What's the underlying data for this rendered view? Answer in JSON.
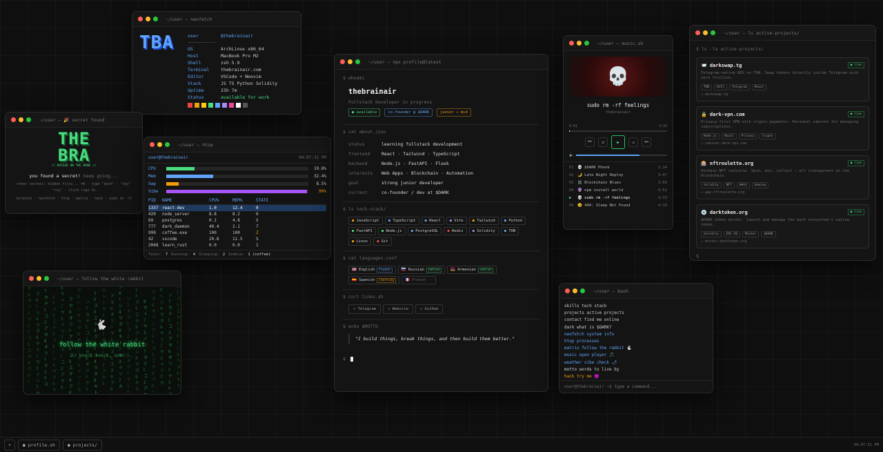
{
  "neofetch": {
    "title": "~/user — neofetch",
    "logo": "TBA",
    "user_label": "user",
    "user_value": "@thebrainair",
    "rows": [
      {
        "k": "OS",
        "v": "ArchLinux x86_64"
      },
      {
        "k": "Host",
        "v": "MacBook Pro M2"
      },
      {
        "k": "Shell",
        "v": "zsh 5.9"
      },
      {
        "k": "Terminal",
        "v": "thebrainair.com"
      },
      {
        "k": "Editor",
        "v": "VSCode + Neovim"
      },
      {
        "k": "Stack",
        "v": "JS TS Python Solidity"
      },
      {
        "k": "Uptime",
        "v": "23h 7m"
      },
      {
        "k": "Status",
        "v": "available for work"
      }
    ],
    "swatches": [
      "#ef4444",
      "#f59e0b",
      "#facc15",
      "#4ade80",
      "#60a5fa",
      "#a78bfa",
      "#ec4899",
      "#ffffff",
      "#555555"
    ]
  },
  "secret": {
    "title": "~/user — 🎉 secret found",
    "logo1": "THE",
    "logo2": "BRA",
    "logo_caption": "// RAISED ON THE BONE //",
    "found": "you found a secret!",
    "keep": "keep going...",
    "hint1": "other secrets: hidden files... ⌘K · type \"bash\" · \"sky\"",
    "hint2": "\"rny\" · click logo 3x",
    "cmds": "terminal · neofetch · htop · matrix · hack · sudo rm -rf"
  },
  "htop": {
    "title": "~/user — htop",
    "header_user": "user@thebrainair",
    "header_time": "04:07:31 PM",
    "meters": [
      {
        "label": "CPU",
        "value": "19.8%",
        "fill": 0.2,
        "color": "#4ade80"
      },
      {
        "label": "Mem",
        "value": "32.4%",
        "fill": 0.33,
        "color": "#60a5fa"
      },
      {
        "label": "Swp",
        "value": "8.5%",
        "fill": 0.085,
        "color": "#f59e0b"
      },
      {
        "label": "Vibe",
        "value": "99%",
        "fill": 0.99,
        "color": "#a855f7"
      }
    ],
    "cols": [
      "PID",
      "NAME",
      "CPU%",
      "MEM%",
      "STATE"
    ],
    "procs": [
      {
        "pid": "1337",
        "name": "react-dev",
        "cpu": "1.0",
        "mem": "12.4",
        "state": "0"
      },
      {
        "pid": "420",
        "name": "node_server",
        "cpu": "8.8",
        "mem": "8.2",
        "state": "0"
      },
      {
        "pid": "69",
        "name": "postgres",
        "cpu": "0.1",
        "mem": "4.8",
        "state": "S"
      },
      {
        "pid": "777",
        "name": "dark_daemon",
        "cpu": "40.4",
        "mem": "2.1",
        "state": "7"
      },
      {
        "pid": "999",
        "name": "coffee.exe",
        "cpu": "100",
        "mem": "100",
        "state": "Z"
      },
      {
        "pid": "42",
        "name": "vscode",
        "cpu": "20.8",
        "mem": "11.5",
        "state": "S"
      },
      {
        "pid": "2048",
        "name": "learn_rust",
        "cpu": "0.0",
        "mem": "0.0",
        "state": "1"
      }
    ],
    "footer": [
      "Tasks:",
      "7",
      "Running:",
      "4",
      "Sleeping:",
      "2",
      "Zombie:",
      "1 (coffee)"
    ]
  },
  "matrix": {
    "title": "~/user — follow the white rabbit",
    "headline": "follow the white rabbit",
    "sub": "// knock knock, user..."
  },
  "profile": {
    "title": "~/user — npx profile@latest",
    "p_whoami": "$ whoami",
    "name": "thebrainair",
    "role": "Fullstack Developer in progress",
    "badges": [
      "● available",
      "co-founder @ $DARK",
      "junior → mid"
    ],
    "p_about": "$ cat about.json",
    "about": [
      {
        "k": "status",
        "v": "learning fullstack development"
      },
      {
        "k": "frontend",
        "v": "React · Tailwind · TypeScript"
      },
      {
        "k": "backend",
        "v": "Node.js · FastAPI · Flask"
      },
      {
        "k": "interests",
        "v": "Web Apps · Blockchain · Automation"
      },
      {
        "k": "goal",
        "v": "strong junior developer"
      },
      {
        "k": "current",
        "v": "co-founder / dev at $DARK"
      }
    ],
    "p_stack": "$ ls tech-stack/",
    "stack": [
      "JavaScript",
      "TypeScript",
      "React",
      "Vite",
      "Tailwind",
      "Python",
      "FastAPI",
      "Node.js",
      "PostgreSQL",
      "Redis",
      "Solidity",
      "TON",
      "Linux",
      "Git"
    ],
    "p_lang": "$ cat languages.conf",
    "langs": [
      {
        "name": "🇺🇸 English",
        "level": "fluent"
      },
      {
        "name": "🇷🇺 Russian",
        "level": "native"
      },
      {
        "name": "🇦🇲 Armenian",
        "level": "native"
      },
      {
        "name": "🇪🇸 Spanish",
        "level": "learning"
      },
      {
        "name": "🇫🇷 French",
        "level": "—"
      }
    ],
    "p_links": "$ curl links.sh",
    "links": [
      "↗ Telegram",
      "↗ Website",
      "↗ GitHub"
    ],
    "p_motto": "$ echo $MOTTO",
    "motto": "\"I build things, break things, and then build them better.\"",
    "prompt": "$"
  },
  "music": {
    "title": "~/user — music.sh",
    "track": "sudo rm -rf feelings",
    "artist": "thebrainair",
    "t_start": "0:01",
    "t_end": "3:33",
    "playlist": [
      {
        "n": "01",
        "name": "💀 $DARK Phonk",
        "t": "2:14"
      },
      {
        "n": "02",
        "name": "🌙 Late Night Deploy",
        "t": "3:47"
      },
      {
        "n": "03",
        "name": "⛓ Blockchain Blues",
        "t": "3:03"
      },
      {
        "n": "04",
        "name": "🔮 npm install world",
        "t": "4:52"
      },
      {
        "n": "▶",
        "name": "💀 sudo rm -rf feelings",
        "t": "3:33"
      },
      {
        "n": "06",
        "name": "😵 404: Sleep Not Found",
        "t": "4:19"
      }
    ]
  },
  "projects": {
    "title": "~/user — ls active-projects/",
    "cmd": "$ ls -la active-projects/",
    "items": [
      {
        "name": "📨 darkswap.tg",
        "status": "● live",
        "desc": "Telegram-native DEX on TON. Swap tokens directly inside Telegram with zero friction.",
        "tags": [
          "TON",
          "Defi",
          "Telegram",
          "React"
        ],
        "url": "→ darkswap.tg"
      },
      {
        "name": "🔒 dark-vpn.com",
        "status": "● live",
        "desc": "Privacy-first VPN with crypto payments. Personal cabinet for managing subscriptions.",
        "tags": [
          "Node.js",
          "React",
          "Privacy",
          "Crypto"
        ],
        "url": "→ cabinet.dark-vpn.com"
      },
      {
        "name": "🎰 nftroulette.org",
        "status": "● live",
        "desc": "Onchain NFT roulette. Spin, win, collect — all transparent on the blockchain.",
        "tags": [
          "Solidity",
          "NFT",
          "Web3",
          "Gaming"
        ],
        "url": "→ app.nftroulette.org"
      },
      {
        "name": "💿 darktoken.org",
        "status": "● live",
        "desc": "$DARK token minter. Launch and manage the dark ecosystem's native token.",
        "tags": [
          "Solidity",
          "ERC-20",
          "Minter",
          "$DARK"
        ],
        "url": "→ minter.darktoken.org"
      }
    ],
    "prompt": "$"
  },
  "bash": {
    "title": "~/user — bash",
    "lines": [
      {
        "t": "skills tech stack",
        "c": "#cfcfcf"
      },
      {
        "t": "projects active projects",
        "c": "#cfcfcf"
      },
      {
        "t": "contact find me online",
        "c": "#cfcfcf"
      },
      {
        "t": "dark what is $DARK?",
        "c": "#cfcfcf"
      },
      {
        "t": "neofetch system info",
        "c": "#60a5fa"
      },
      {
        "t": "htop processes",
        "c": "#60a5fa"
      },
      {
        "t": "matrix follow the rabbit 🐇",
        "c": "#60a5fa"
      },
      {
        "t": "music open player 🎵",
        "c": "#60a5fa"
      },
      {
        "t": "weather vibe check 🌶",
        "c": "#60a5fa"
      },
      {
        "t": "motto words to live by",
        "c": "#cfcfcf"
      },
      {
        "t": "hack try me 😈",
        "c": "#f59e0b"
      }
    ],
    "prompt": "user@thebrainair ~$",
    "placeholder": "type a command..."
  },
  "taskbar": {
    "plus": "+",
    "tasks": [
      "● profile.sh",
      "● projects/"
    ],
    "time": "04:07:31 PM"
  }
}
